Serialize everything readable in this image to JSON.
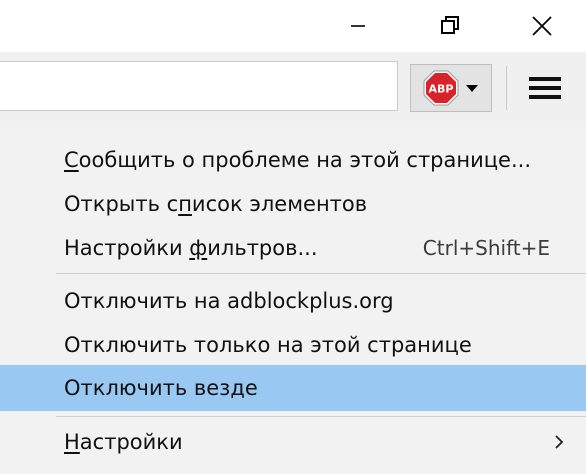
{
  "menu": {
    "items": [
      {
        "pre": "",
        "ul": "С",
        "post": "ообщить о проблеме на этой странице..."
      },
      {
        "pre": "Открыть с",
        "ul": "п",
        "post": "исок элементов"
      },
      {
        "pre": "Настройки ",
        "ul": "ф",
        "post": "ильтров...",
        "shortcut": "Ctrl+Shift+E"
      },
      {
        "pre": "Отключить на adblockplus.org",
        "ul": "",
        "post": ""
      },
      {
        "pre": "Отключить только на этой странице",
        "ul": "",
        "post": ""
      },
      {
        "pre": "Отключить везде",
        "ul": "",
        "post": ""
      },
      {
        "pre": "",
        "ul": "Н",
        "post": "астройки"
      }
    ]
  },
  "abp": {
    "icon_text": "ABP"
  },
  "colors": {
    "highlight": "#99c9f3",
    "abp_red": "#d8232a",
    "menu_bg": "#f2f2f2",
    "toolbar_bg": "#f0f0f0"
  },
  "icons": {
    "minimize": "minimize-icon",
    "restore": "restore-icon",
    "close": "close-icon",
    "abp": "adblock-plus-icon",
    "dropdown": "chevron-down-icon",
    "menu": "hamburger-menu-icon",
    "submenu": "chevron-right-icon"
  }
}
